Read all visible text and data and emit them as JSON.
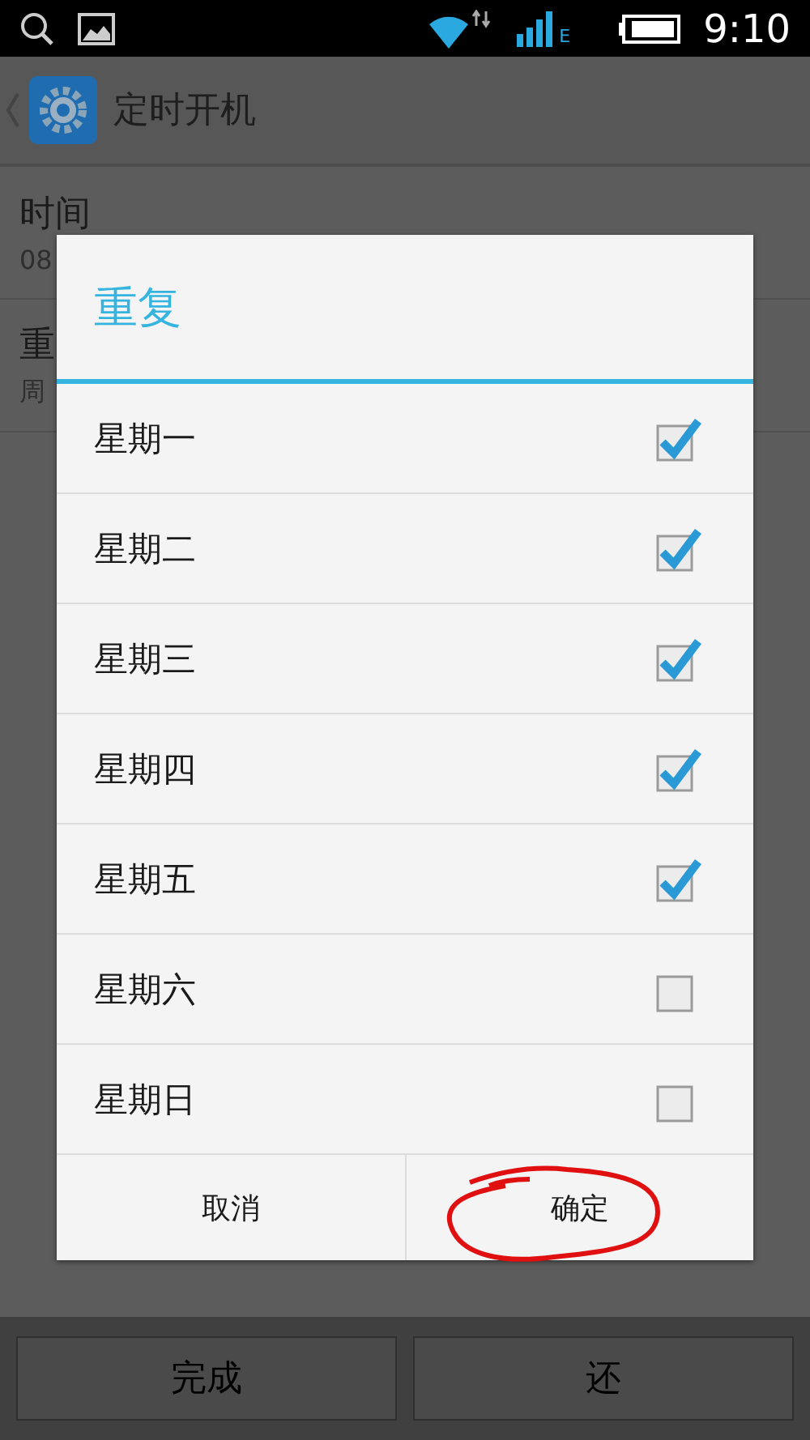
{
  "status_bar": {
    "time": "9:10",
    "network": "E"
  },
  "app_bar": {
    "title": "定时开机"
  },
  "settings": [
    {
      "title": "时间",
      "summary": "08"
    },
    {
      "title": "重",
      "summary": "周"
    }
  ],
  "dialog": {
    "title": "重复",
    "options": [
      {
        "label": "星期一",
        "checked": true
      },
      {
        "label": "星期二",
        "checked": true
      },
      {
        "label": "星期三",
        "checked": true
      },
      {
        "label": "星期四",
        "checked": true
      },
      {
        "label": "星期五",
        "checked": true
      },
      {
        "label": "星期六",
        "checked": false
      },
      {
        "label": "星期日",
        "checked": false
      }
    ],
    "buttons": [
      "取消",
      "确定"
    ]
  },
  "bottom_buttons": [
    "完成",
    "还"
  ]
}
